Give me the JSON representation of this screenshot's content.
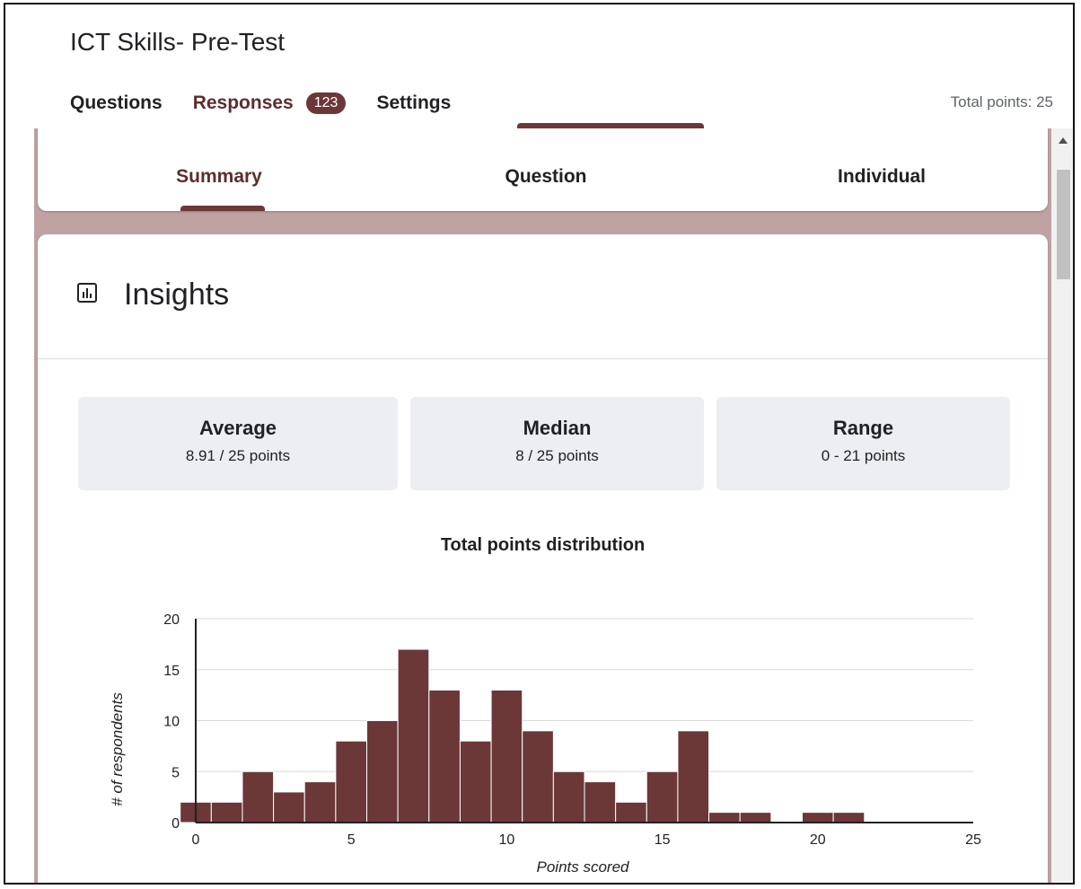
{
  "form": {
    "title": "ICT Skills- Pre-Test"
  },
  "nav": {
    "questions": "Questions",
    "responses": "Responses",
    "responses_count": "123",
    "settings": "Settings",
    "total_points": "Total points: 25"
  },
  "subtabs": {
    "summary": "Summary",
    "question": "Question",
    "individual": "Individual"
  },
  "insights": {
    "title": "Insights",
    "average_label": "Average",
    "average_value": "8.91 / 25 points",
    "median_label": "Median",
    "median_value": "8 / 25 points",
    "range_label": "Range",
    "range_value": "0 - 21 points"
  },
  "colors": {
    "accent": "#6b3737",
    "accent_light": "#bfa3a3"
  },
  "chart_data": {
    "type": "bar",
    "title": "Total points distribution",
    "xlabel": "Points scored",
    "ylabel": "# of respondents",
    "x": [
      0,
      1,
      2,
      3,
      4,
      5,
      6,
      7,
      8,
      9,
      10,
      11,
      12,
      13,
      14,
      15,
      16,
      17,
      18,
      19,
      20,
      21,
      22,
      23,
      24,
      25
    ],
    "values": [
      2,
      2,
      5,
      3,
      4,
      8,
      10,
      17,
      13,
      8,
      13,
      9,
      5,
      4,
      2,
      5,
      9,
      1,
      1,
      0,
      1,
      1,
      0,
      0,
      0,
      0
    ],
    "xlim": [
      0,
      25
    ],
    "ylim": [
      0,
      20
    ],
    "xticks": [
      0,
      5,
      10,
      15,
      20,
      25
    ],
    "yticks": [
      0,
      5,
      10,
      15,
      20
    ],
    "grid": true
  }
}
